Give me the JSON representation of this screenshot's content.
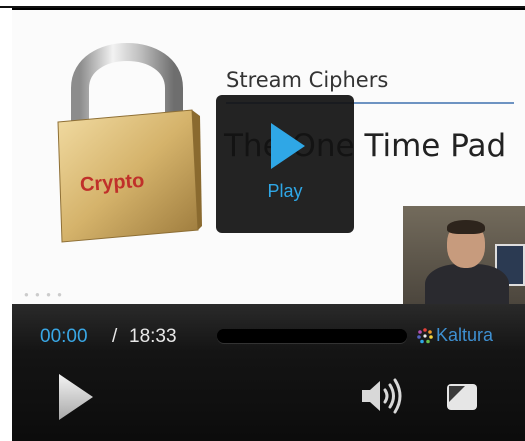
{
  "slide": {
    "subtitle": "Stream Ciphers",
    "title": "The One Time Pad",
    "padlock_label": "Crypto"
  },
  "overlay": {
    "play_label": "Play"
  },
  "controls": {
    "current_time": "00:00",
    "separator": "/",
    "total_time": "18:33",
    "progress": 0
  },
  "branding": {
    "name": "Kaltura"
  },
  "icons": {
    "big_play": "play-icon",
    "play": "play-icon",
    "volume": "volume-icon",
    "fullscreen": "fullscreen-icon",
    "brand": "kaltura-logo-icon"
  },
  "colors": {
    "accent": "#2fa7e6",
    "time_current": "#39a7e5",
    "slide_rule": "#6d93c2",
    "padlock_text": "#c0302a"
  }
}
